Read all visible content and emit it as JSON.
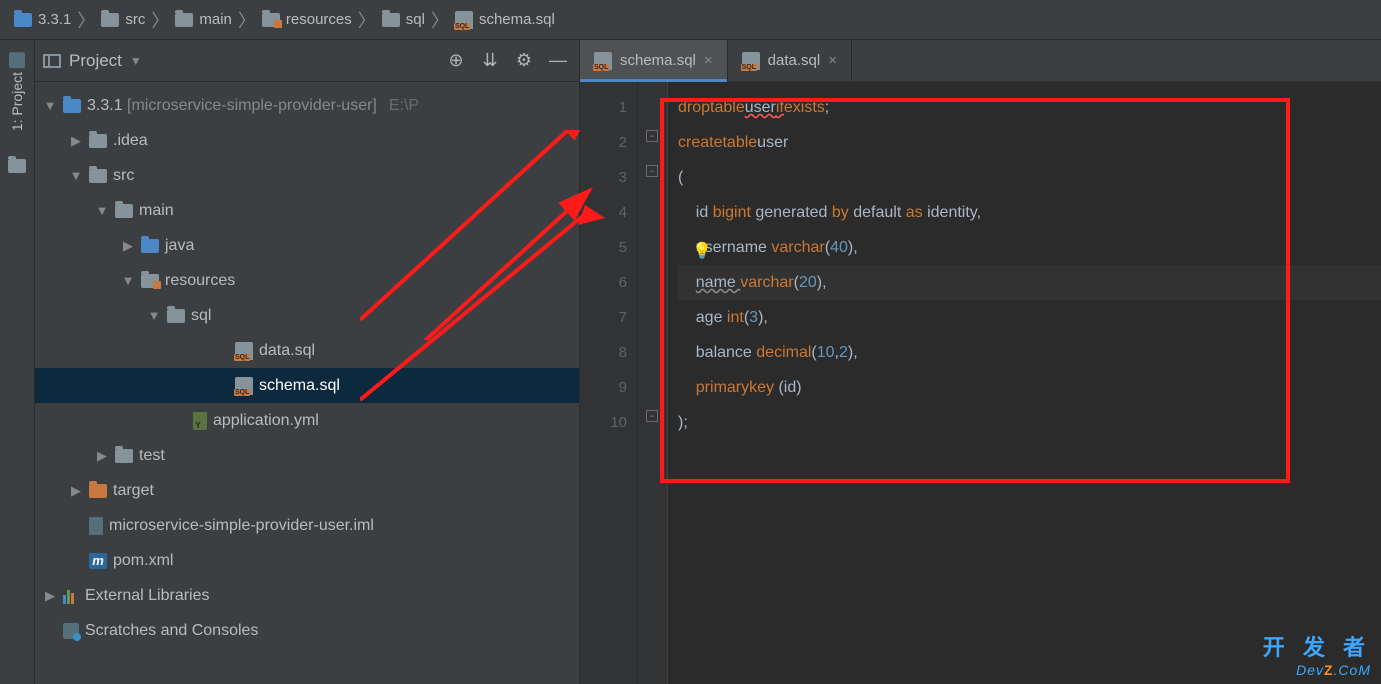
{
  "breadcrumb": [
    {
      "icon": "folder-blue",
      "label": "3.3.1"
    },
    {
      "icon": "folder",
      "label": "src"
    },
    {
      "icon": "folder",
      "label": "main"
    },
    {
      "icon": "res-folder",
      "label": "resources"
    },
    {
      "icon": "folder",
      "label": "sql"
    },
    {
      "icon": "sql-file",
      "label": "schema.sql"
    }
  ],
  "left_bar": {
    "tab_label": "1: Project"
  },
  "project_panel": {
    "title": "Project"
  },
  "tree": [
    {
      "indent": 0,
      "expand": "down",
      "icon": "folder-blue",
      "label": "3.3.1",
      "bracket": "[microservice-simple-provider-user]",
      "suffix": "E:\\P"
    },
    {
      "indent": 1,
      "expand": "right",
      "icon": "folder",
      "label": ".idea"
    },
    {
      "indent": 1,
      "expand": "down",
      "icon": "folder",
      "label": "src"
    },
    {
      "indent": 2,
      "expand": "down",
      "icon": "folder",
      "label": "main"
    },
    {
      "indent": 3,
      "expand": "right",
      "icon": "folder-blue",
      "label": "java"
    },
    {
      "indent": 3,
      "expand": "down",
      "icon": "res-folder",
      "label": "resources"
    },
    {
      "indent": 4,
      "expand": "down",
      "icon": "folder",
      "label": "sql"
    },
    {
      "indent": 6,
      "icon": "sql-file",
      "label": "data.sql"
    },
    {
      "indent": 6,
      "icon": "sql-file",
      "label": "schema.sql",
      "selected": true
    },
    {
      "indent": 5,
      "icon": "yml-file",
      "label": "application.yml"
    },
    {
      "indent": 2,
      "expand": "right",
      "icon": "folder",
      "label": "test"
    },
    {
      "indent": 1,
      "expand": "right",
      "icon": "folder-orange",
      "label": "target"
    },
    {
      "indent": 1,
      "icon": "iml-file",
      "label": "microservice-simple-provider-user.iml"
    },
    {
      "indent": 1,
      "icon": "m-file",
      "label": "pom.xml"
    },
    {
      "indent": 0,
      "expand": "right",
      "icon": "lib",
      "label": "External Libraries"
    },
    {
      "indent": 0,
      "icon": "scratch",
      "label": "Scratches and Consoles"
    }
  ],
  "editor_tabs": [
    {
      "icon": "sql-file",
      "label": "schema.sql",
      "active": true
    },
    {
      "icon": "sql-file",
      "label": "data.sql",
      "active": false
    }
  ],
  "gutter_lines": [
    "1",
    "2",
    "3",
    "4",
    "5",
    "6",
    "7",
    "8",
    "9",
    "10"
  ],
  "code": {
    "l1": {
      "kw1": "drop",
      "kw2": "table",
      "id": "user",
      "kw3": "if",
      "kw4": "exists",
      "semi": ";"
    },
    "l2": {
      "kw1": "create",
      "kw2": "table",
      "id": "user"
    },
    "l3": {
      "txt": "("
    },
    "l4": {
      "pad": "    ",
      "col": "id ",
      "type": "bigint",
      "rest1": " generated ",
      "kw1": "by",
      "rest2": " default ",
      "kw2": "as",
      "rest3": " identity,"
    },
    "l5": {
      "pad": "    ",
      "col": "username ",
      "type": "varchar",
      "open": "(",
      "num": "40",
      "close": "),"
    },
    "l6": {
      "pad": "    ",
      "col": "name ",
      "type": "varchar",
      "open": "(",
      "num": "20",
      "close": "),"
    },
    "l7": {
      "pad": "    ",
      "col": "age ",
      "type": "int",
      "open": "(",
      "num": "3",
      "close": "),"
    },
    "l8": {
      "pad": "    ",
      "col": "balance ",
      "type": "decimal",
      "open": "(",
      "num1": "10",
      "comma": ",",
      "num2": "2",
      "close": "),"
    },
    "l9": {
      "pad": "    ",
      "kw1": "primary",
      "kw2": "key",
      "rest": " (id)"
    },
    "l10": {
      "txt": ");"
    }
  },
  "watermark": {
    "cn": "开 发 者",
    "en_prefix": "Dev",
    "en_mid": "Z",
    "en_suffix": ".CoM"
  }
}
